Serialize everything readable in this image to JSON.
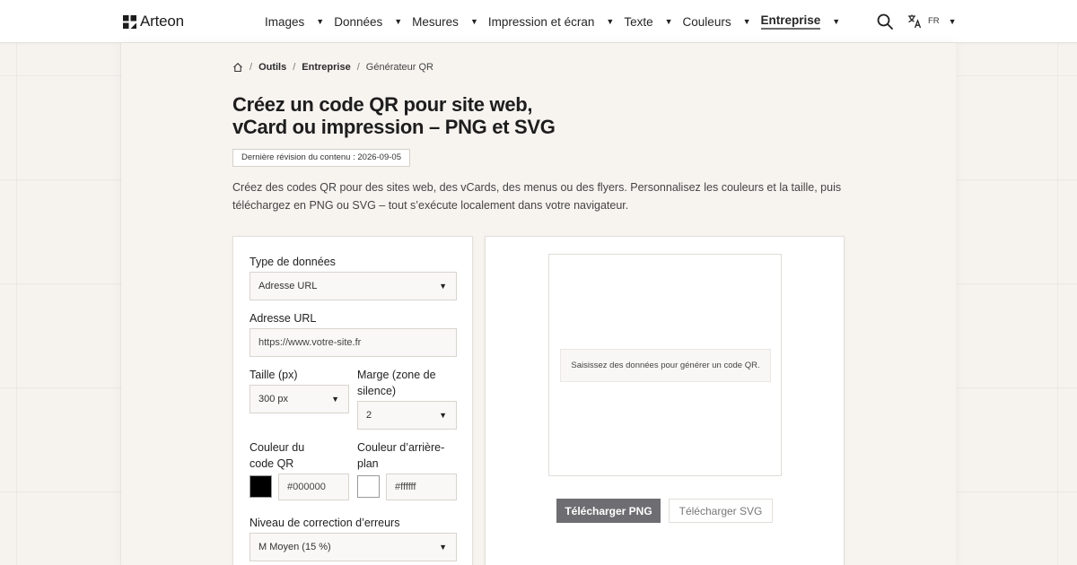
{
  "brand": {
    "name": "Arteon"
  },
  "nav": {
    "items": [
      {
        "label": "Images",
        "active": false
      },
      {
        "label": "Données",
        "active": false
      },
      {
        "label": "Mesures",
        "active": false
      },
      {
        "label": "Impression et écran",
        "active": false
      },
      {
        "label": "Texte",
        "active": false
      },
      {
        "label": "Couleurs",
        "active": false
      },
      {
        "label": "Entreprise",
        "active": true
      }
    ],
    "caret": "▼",
    "language": "FR"
  },
  "breadcrumb": {
    "items": [
      "Outils",
      "Entreprise"
    ],
    "current": "Générateur QR",
    "separator": "/"
  },
  "page": {
    "title_line1": "Créez un code QR pour site web,",
    "title_line2": "vCard ou impression – PNG et SVG",
    "revision": "Dernière révision du contenu : 2026-09-05",
    "intro": "Créez des codes QR pour des sites web, des vCards, des menus ou des flyers. Personnalisez les couleurs et la taille, puis téléchargez en PNG ou SVG – tout s’exécute localement dans votre navigateur."
  },
  "form": {
    "data_type": {
      "label": "Type de données",
      "value": "Adresse URL"
    },
    "url": {
      "label": "Adresse URL",
      "placeholder": "https://www.votre-site.fr"
    },
    "size": {
      "label": "Taille (px)",
      "value": "300 px"
    },
    "margin": {
      "label_line1": "Marge (zone de",
      "label_line2": "silence)",
      "value": "2"
    },
    "fg_color": {
      "label_line1": "Couleur du",
      "label_line2": "code QR",
      "value": "#000000",
      "swatch": "#000000"
    },
    "bg_color": {
      "label_line1": "Couleur d’arrière-",
      "label_line2": "plan",
      "value": "#ffffff",
      "swatch": "#ffffff"
    },
    "error_correction": {
      "label": "Niveau de correction d’erreurs",
      "value": "M Moyen (15 %)"
    }
  },
  "preview": {
    "placeholder": "Saisissez des données pour générer un code QR.",
    "download_png": "Télécharger PNG",
    "download_svg": "Télécharger SVG"
  },
  "colors": {
    "accent_button": "#6e6e72",
    "page_background": "#f6f3ef"
  }
}
